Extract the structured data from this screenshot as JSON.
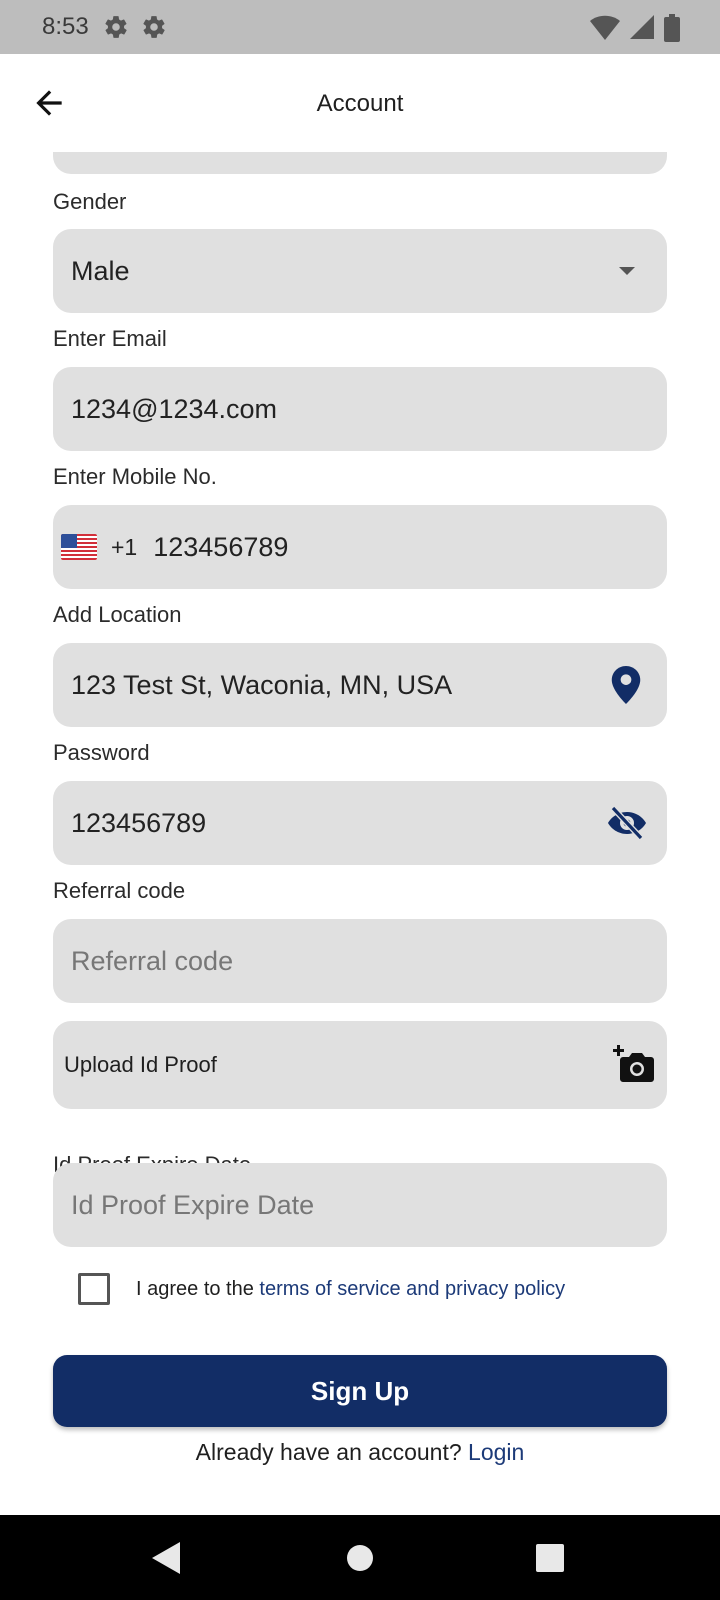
{
  "status_bar": {
    "time": "8:53"
  },
  "app_bar": {
    "title": "Account"
  },
  "form": {
    "gender": {
      "label": "Gender",
      "value": "Male"
    },
    "email": {
      "label": "Enter Email",
      "value": "1234@1234.com"
    },
    "mobile": {
      "label": "Enter Mobile No.",
      "dial_code": "+1",
      "value": "123456789",
      "flag": "us-flag"
    },
    "location": {
      "label": "Add Location",
      "value": "123 Test St, Waconia, MN, USA"
    },
    "password": {
      "label": "Password",
      "value": "123456789"
    },
    "referral": {
      "label": "Referral code",
      "placeholder": "Referral code"
    },
    "upload": {
      "label": "Upload Id Proof"
    },
    "expire": {
      "label": "Id Proof Expire Date",
      "placeholder": "Id Proof Expire Date"
    },
    "agree": {
      "prefix": "I agree to the ",
      "link": "terms of service and privacy policy"
    },
    "signup_label": "Sign Up",
    "login": {
      "prefix": "Already have an account? ",
      "link": "Login"
    }
  },
  "colors": {
    "brand": "#122d66",
    "link": "#1c3a78",
    "field": "#e0e0e0"
  }
}
